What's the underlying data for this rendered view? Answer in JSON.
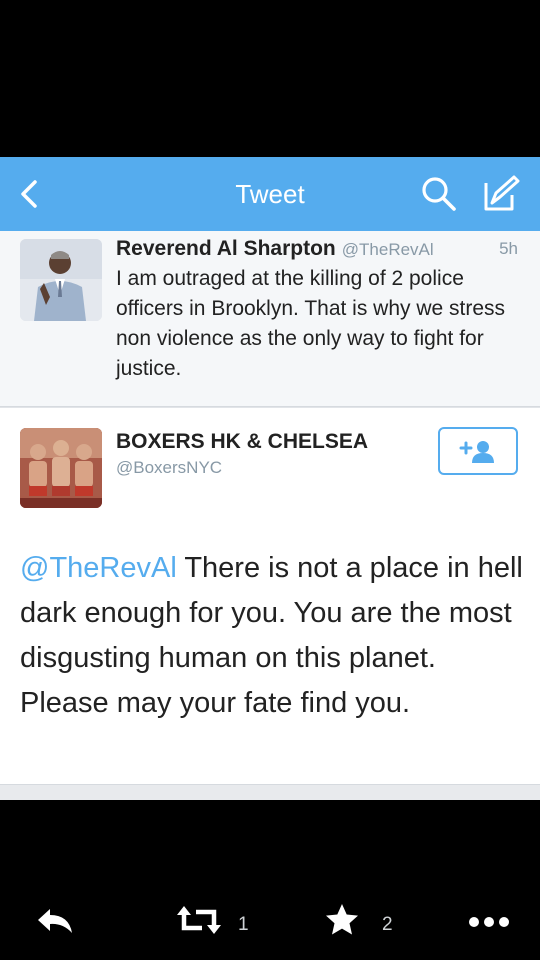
{
  "navbar": {
    "title": "Tweet",
    "icons": [
      "back-icon",
      "search-icon",
      "compose-icon"
    ],
    "color": "#55acee"
  },
  "parent_tweet": {
    "name": "Reverend Al Sharpton",
    "handle": "@TheRevAl",
    "time": "5h",
    "text": "I am outraged at the killing of 2 police officers in Brooklyn. That is why we stress non violence as the only way to fight for justice."
  },
  "main_tweet": {
    "name": "BOXERS HK & CHELSEA",
    "handle": "@BoxersNYC",
    "mention": "@TheRevAl",
    "text": " There is not a place in hell dark enough for you. You are the most disgusting human on this planet. Please may your fate find you."
  },
  "actions": {
    "retweet_count": "1",
    "favorite_count": "2",
    "icons": [
      "reply-icon",
      "retweet-icon",
      "star-icon",
      "more-icon"
    ]
  }
}
